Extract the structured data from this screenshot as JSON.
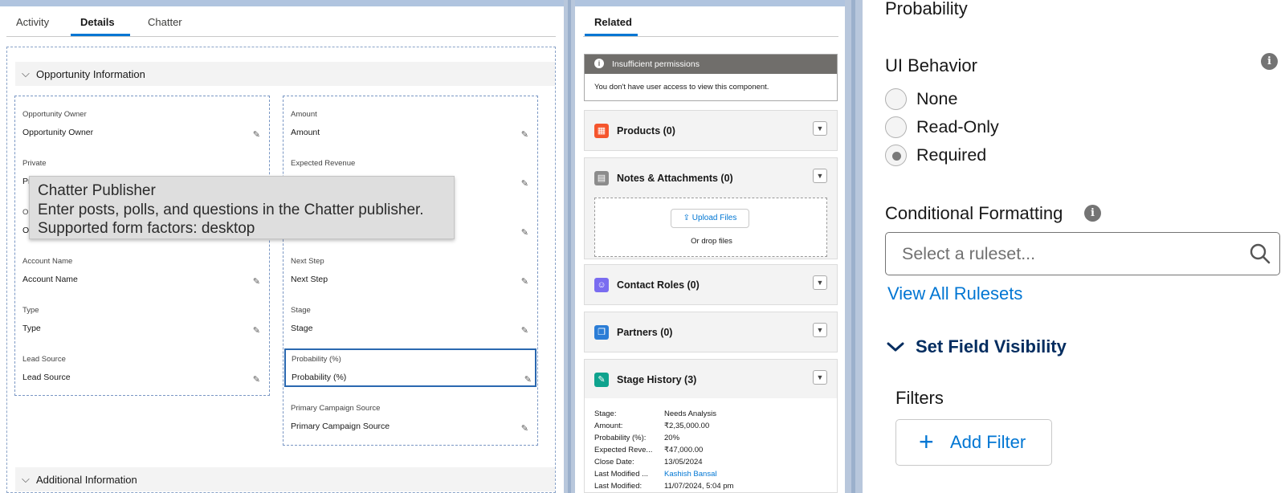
{
  "details": {
    "tabs": [
      {
        "label": "Activity"
      },
      {
        "label": "Details"
      },
      {
        "label": "Chatter"
      }
    ],
    "sections": {
      "opportunity_info": "Opportunity Information",
      "additional_info": "Additional Information"
    },
    "left_fields": [
      {
        "label": "Opportunity Owner",
        "value": "Opportunity Owner"
      },
      {
        "label": "Private",
        "value": "Pr"
      },
      {
        "label": "Op",
        "value": "Op"
      },
      {
        "label": "Account Name",
        "value": "Account Name"
      },
      {
        "label": "Type",
        "value": "Type"
      },
      {
        "label": "Lead Source",
        "value": "Lead Source"
      }
    ],
    "right_fields": [
      {
        "label": "Amount",
        "value": "Amount"
      },
      {
        "label": "Expected Revenue",
        "value": ""
      },
      {
        "label": "",
        "value": ""
      },
      {
        "label": "Next Step",
        "value": "Next Step"
      },
      {
        "label": "Stage",
        "value": "Stage"
      },
      {
        "label": "Probability (%)",
        "value": "Probability (%)"
      },
      {
        "label": "Primary Campaign Source",
        "value": "Primary Campaign Source"
      }
    ],
    "tooltip": {
      "title": "Chatter Publisher",
      "line1": "Enter posts, polls, and questions in the Chatter publisher.",
      "line2": "Supported form factors: desktop"
    }
  },
  "related": {
    "tab": "Related",
    "permission": {
      "title": "Insufficient permissions",
      "message": "You don't have user access to view this component."
    },
    "cards": [
      {
        "title": "Products (0)",
        "icon": "products-icon",
        "color": "#f5552d"
      },
      {
        "title": "Notes & Attachments (0)",
        "icon": "notes-icon",
        "color": "#8c8c8c"
      },
      {
        "title": "Contact Roles (0)",
        "icon": "contact-roles-icon",
        "color": "#7a6cf0"
      },
      {
        "title": "Partners (0)",
        "icon": "partners-icon",
        "color": "#2b7dd6"
      },
      {
        "title": "Stage History (3)",
        "icon": "stage-history-icon",
        "color": "#0fa38e"
      }
    ],
    "upload": {
      "button": "Upload Files",
      "drop": "Or drop files"
    },
    "stage_history": [
      {
        "k": "Stage:",
        "v": "Needs Analysis"
      },
      {
        "k": "Amount:",
        "v": "₹2,35,000.00"
      },
      {
        "k": "Probability (%):",
        "v": "20%"
      },
      {
        "k": "Expected Reve...",
        "v": "₹47,000.00"
      },
      {
        "k": "Close Date:",
        "v": "13/05/2024"
      },
      {
        "k": "Last Modified ...",
        "v": "Kashish Bansal"
      },
      {
        "k": "Last Modified:",
        "v": "11/07/2024, 5:04 pm"
      }
    ]
  },
  "properties": {
    "title": "Probability",
    "ui_behavior": {
      "label": "UI Behavior",
      "options": [
        "None",
        "Read-Only",
        "Required"
      ],
      "selected": "Required"
    },
    "conditional_formatting": {
      "label": "Conditional Formatting",
      "placeholder": "Select a ruleset...",
      "view_all": "View All Rulesets"
    },
    "field_visibility": {
      "label": "Set Field Visibility",
      "filters": "Filters",
      "add_filter": "Add Filter"
    }
  }
}
